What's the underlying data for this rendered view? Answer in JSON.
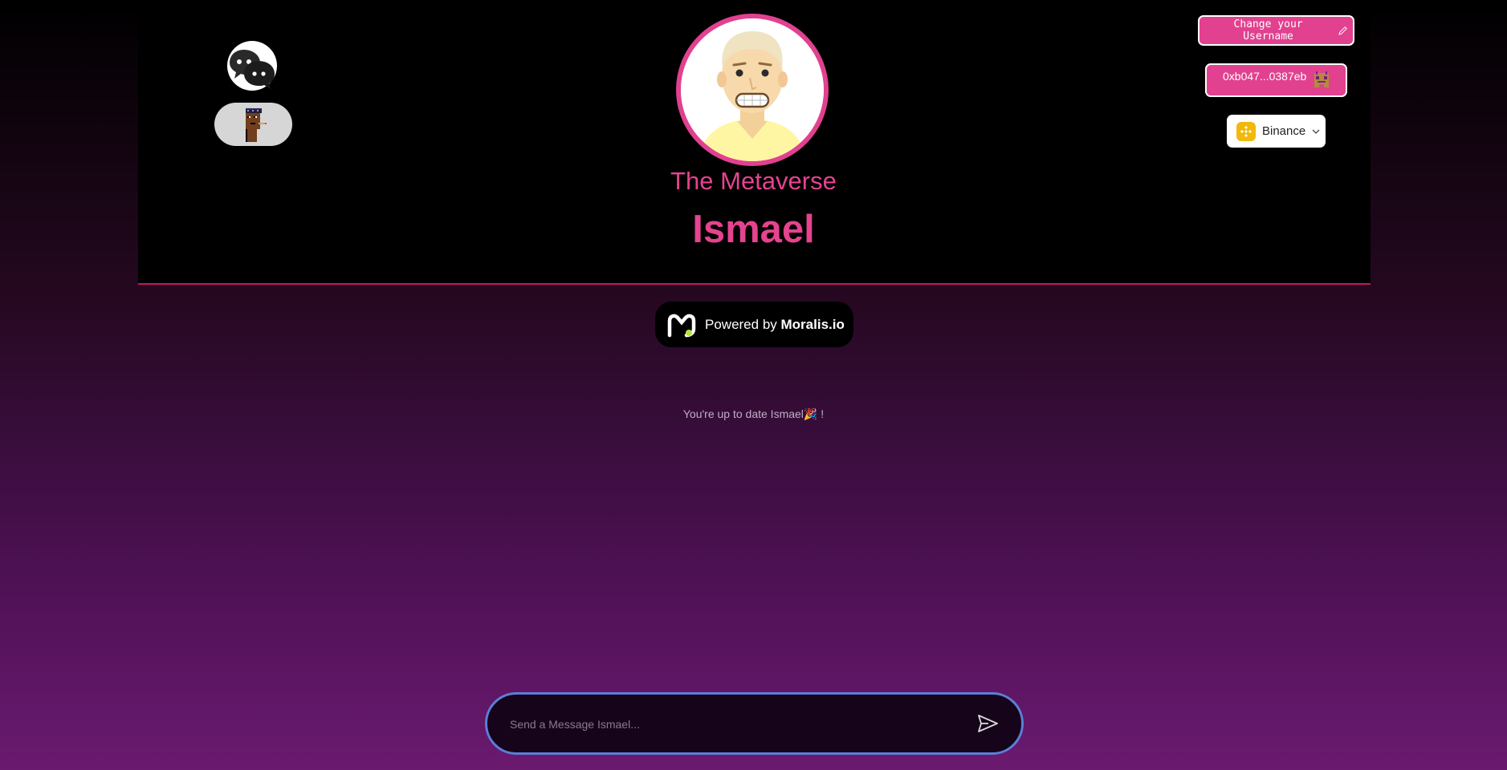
{
  "header": {
    "subtitle": "The Metaverse",
    "username": "Ismael",
    "change_username_label": "Change your Username",
    "wallet_address": "0xb047...0387eb",
    "chain": {
      "label": "Binance",
      "icon": "binance-icon"
    },
    "icons": {
      "chat_logo": "chat-bubbles-icon",
      "punk_avatar": "cryptopunk-icon",
      "edit": "pencil-icon",
      "dropdown": "chevron-down-icon"
    }
  },
  "powered_by": {
    "prefix": "Powered by",
    "brand": "Moralis.io"
  },
  "status": {
    "text": "You're up to date Ismael🎉 !"
  },
  "composer": {
    "placeholder": "Send a Message Ismael...",
    "send_icon": "send-icon"
  },
  "colors": {
    "accent": "#e1418f",
    "input_border": "#5b7fd6",
    "header_divider": "#c2185b"
  }
}
